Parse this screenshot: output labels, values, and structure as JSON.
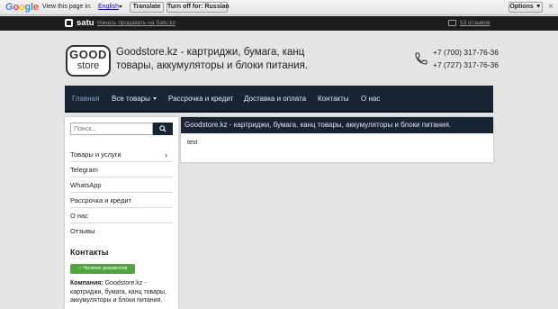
{
  "translate_bar": {
    "logo": "Google",
    "view_text": "View this page in:",
    "language": "English",
    "translate_label": "Translate",
    "turn_off_label": "Turn off for: Russian",
    "options_label": "Options ▼",
    "close_glyph": "×",
    "logo_colors": [
      "#4285f4",
      "#ea4335",
      "#fbbc05",
      "#4285f4",
      "#34a853",
      "#ea4335"
    ]
  },
  "satu_bar": {
    "logo": "satu",
    "link": "Начать продавать на Satu.kz",
    "reviews": "53 отзывов"
  },
  "header": {
    "brand_top": "GOOD",
    "brand_bottom": "store",
    "title": "Goodstore.kz - картриджи, бумага, канц товары, аккумуляторы и блоки питания.",
    "phones": [
      "+7 (700) 317-76-36",
      "+7 (727) 317-76-36"
    ],
    "phone_icon": "phone-icon"
  },
  "nav": {
    "items": [
      {
        "label": "Главная",
        "active": true
      },
      {
        "label": "Все товары",
        "dropdown": true
      },
      {
        "label": "Рассрочка и кредит"
      },
      {
        "label": "Доставка и оплата"
      },
      {
        "label": "Контакты"
      },
      {
        "label": "О нас"
      }
    ],
    "accent_color": "#172434"
  },
  "sidebar": {
    "search": {
      "placeholder": "Поиск...",
      "value": ""
    },
    "menu": [
      {
        "label": "Товары и услуги",
        "arrow": "›"
      },
      {
        "label": "Telegram"
      },
      {
        "label": "WhatsApp"
      },
      {
        "label": "Рассрочка и кредит"
      },
      {
        "label": "О нас"
      },
      {
        "label": "Отзывы"
      }
    ],
    "contacts_title": "Контакты",
    "docs_badge": "✓ Наличие документов",
    "company_label": "Компания:",
    "company_name": "Goodstore.kz - картриджи, бумага, канц товары, аккумуляторы и блоки питания."
  },
  "main": {
    "heading": "Goodstore.kz - картриджи, бумага, канц товары, аккумуляторы и блоки питания.",
    "body": "test"
  }
}
